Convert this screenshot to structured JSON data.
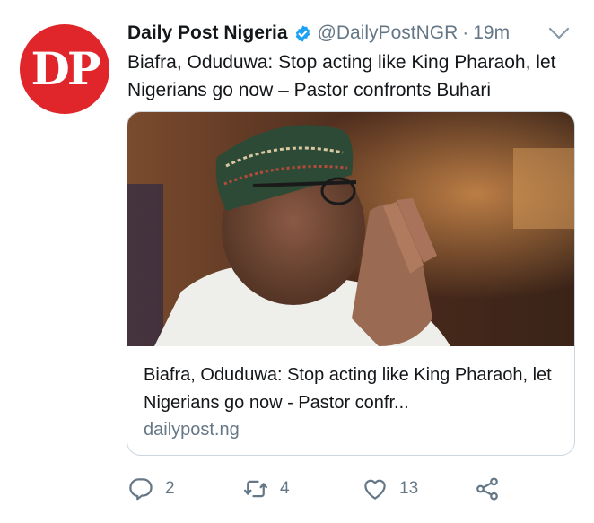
{
  "account": {
    "avatar_text": "DP",
    "name": "Daily Post Nigeria",
    "handle": "@DailyPostNGR",
    "separator": "·",
    "time": "19m"
  },
  "tweet": {
    "text": "Biafra, Oduduwa: Stop acting like King Pharaoh, let Nigerians go now – Pastor confronts Buhari"
  },
  "card": {
    "title": "Biafra, Oduduwa: Stop acting like King Pharaoh, let Nigerians go now - Pastor confr...",
    "domain": "dailypost.ng"
  },
  "actions": {
    "replies": "2",
    "retweets": "4",
    "likes": "13"
  },
  "colors": {
    "avatar_bg": "#e0262a",
    "verified": "#1da1f2",
    "secondary_text": "#657786",
    "border": "#ccd6dd"
  },
  "icons": [
    "verified-badge-icon",
    "chevron-down-icon",
    "reply-icon",
    "retweet-icon",
    "like-icon",
    "share-icon"
  ]
}
